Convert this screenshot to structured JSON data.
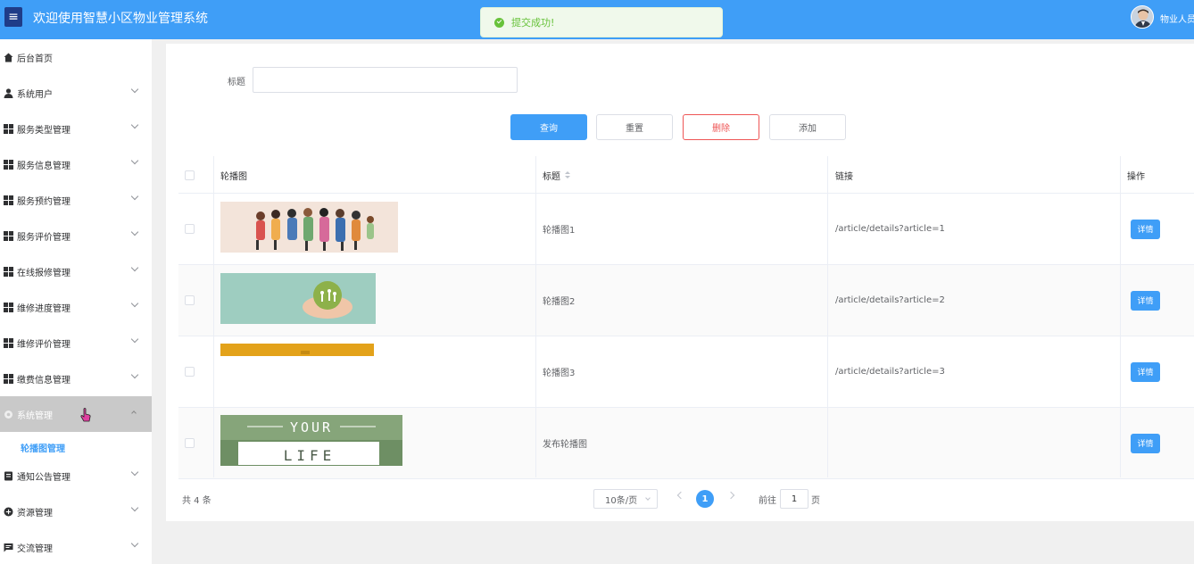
{
  "header": {
    "menu_icon": "hamburger-icon",
    "title": "欢迎使用智慧小区物业管理系统",
    "username": "物业人员",
    "colors": {
      "header_bg": "#3f9ef7",
      "primary": "#3f9ef7",
      "danger": "#e55555",
      "success": "#67c23a"
    }
  },
  "toast": {
    "text": "提交成功!",
    "icon": "check-circle-icon"
  },
  "sidebar": {
    "items": [
      {
        "label": "后台首页",
        "icon": "home-icon"
      },
      {
        "label": "系统用户",
        "icon": "user-icon"
      },
      {
        "label": "服务类型管理",
        "icon": "grid-icon"
      },
      {
        "label": "服务信息管理",
        "icon": "grid-icon"
      },
      {
        "label": "服务预约管理",
        "icon": "grid-icon"
      },
      {
        "label": "服务评价管理",
        "icon": "grid-icon"
      },
      {
        "label": "在线报修管理",
        "icon": "grid-icon"
      },
      {
        "label": "维修进度管理",
        "icon": "grid-icon"
      },
      {
        "label": "维修评价管理",
        "icon": "grid-icon"
      },
      {
        "label": "缴费信息管理",
        "icon": "grid-icon"
      },
      {
        "label": "系统管理",
        "icon": "gear-icon"
      },
      {
        "label": "通知公告管理",
        "icon": "doc-icon"
      },
      {
        "label": "资源管理",
        "icon": "plus-circle-icon"
      },
      {
        "label": "交流管理",
        "icon": "chat-icon"
      }
    ],
    "sub_item": "轮播图管理"
  },
  "search": {
    "label": "标题",
    "value": "",
    "placeholder": ""
  },
  "buttons": {
    "query": "查询",
    "reset": "重置",
    "delete": "删除",
    "add": "添加"
  },
  "table": {
    "columns": [
      "轮播图",
      "标题",
      "链接",
      "操作"
    ],
    "rows": [
      {
        "title": "轮播图1",
        "link": "/article/details?article=1",
        "action": "详情",
        "image": "people-crowd"
      },
      {
        "title": "轮播图2",
        "link": "/article/details?article=2",
        "action": "详情",
        "image": "hands-globe"
      },
      {
        "title": "轮播图3",
        "link": "/article/details?article=3",
        "action": "详情",
        "image": "yellow-strip"
      },
      {
        "title": "发布轮播图",
        "link": "",
        "action": "详情",
        "image": "your-life"
      }
    ],
    "image_text": {
      "line1": "YOUR",
      "line2": "LIFE"
    }
  },
  "pagination": {
    "total": "共 4 条",
    "page_size": "10条/页",
    "current": "1",
    "goto_prefix": "前往",
    "goto_value": "1",
    "goto_suffix": "页"
  }
}
